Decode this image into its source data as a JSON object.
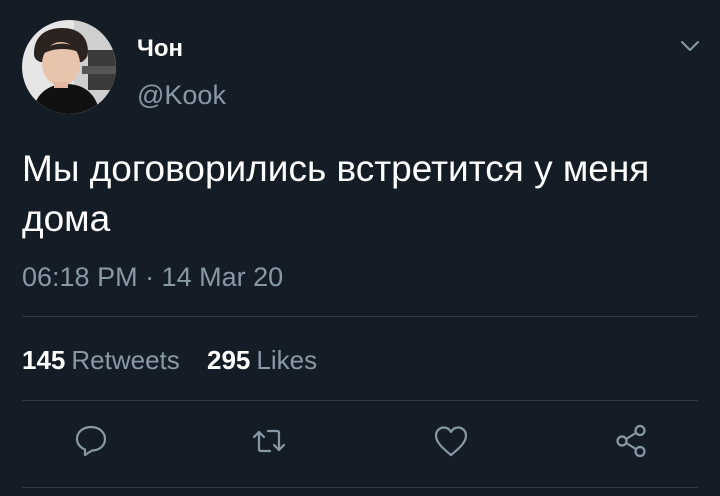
{
  "tweet": {
    "author": {
      "display_name": "Чон",
      "handle": "@Kook"
    },
    "text": "Мы договорились встретится у меня дома",
    "timestamp": "06:18 PM · 14 Mar 20",
    "stats": {
      "retweets_count": "145",
      "retweets_label": "Retweets",
      "likes_count": "295",
      "likes_label": "Likes"
    }
  },
  "actions": {
    "reply_icon": "comment-bubble-icon",
    "retweet_icon": "retweet-arrows-icon",
    "like_icon": "heart-icon",
    "share_icon": "share-nodes-icon"
  },
  "colors": {
    "background": "#141d26",
    "primary_text": "#ffffff",
    "secondary_text": "#8899a6",
    "divider": "#2f3a45"
  }
}
